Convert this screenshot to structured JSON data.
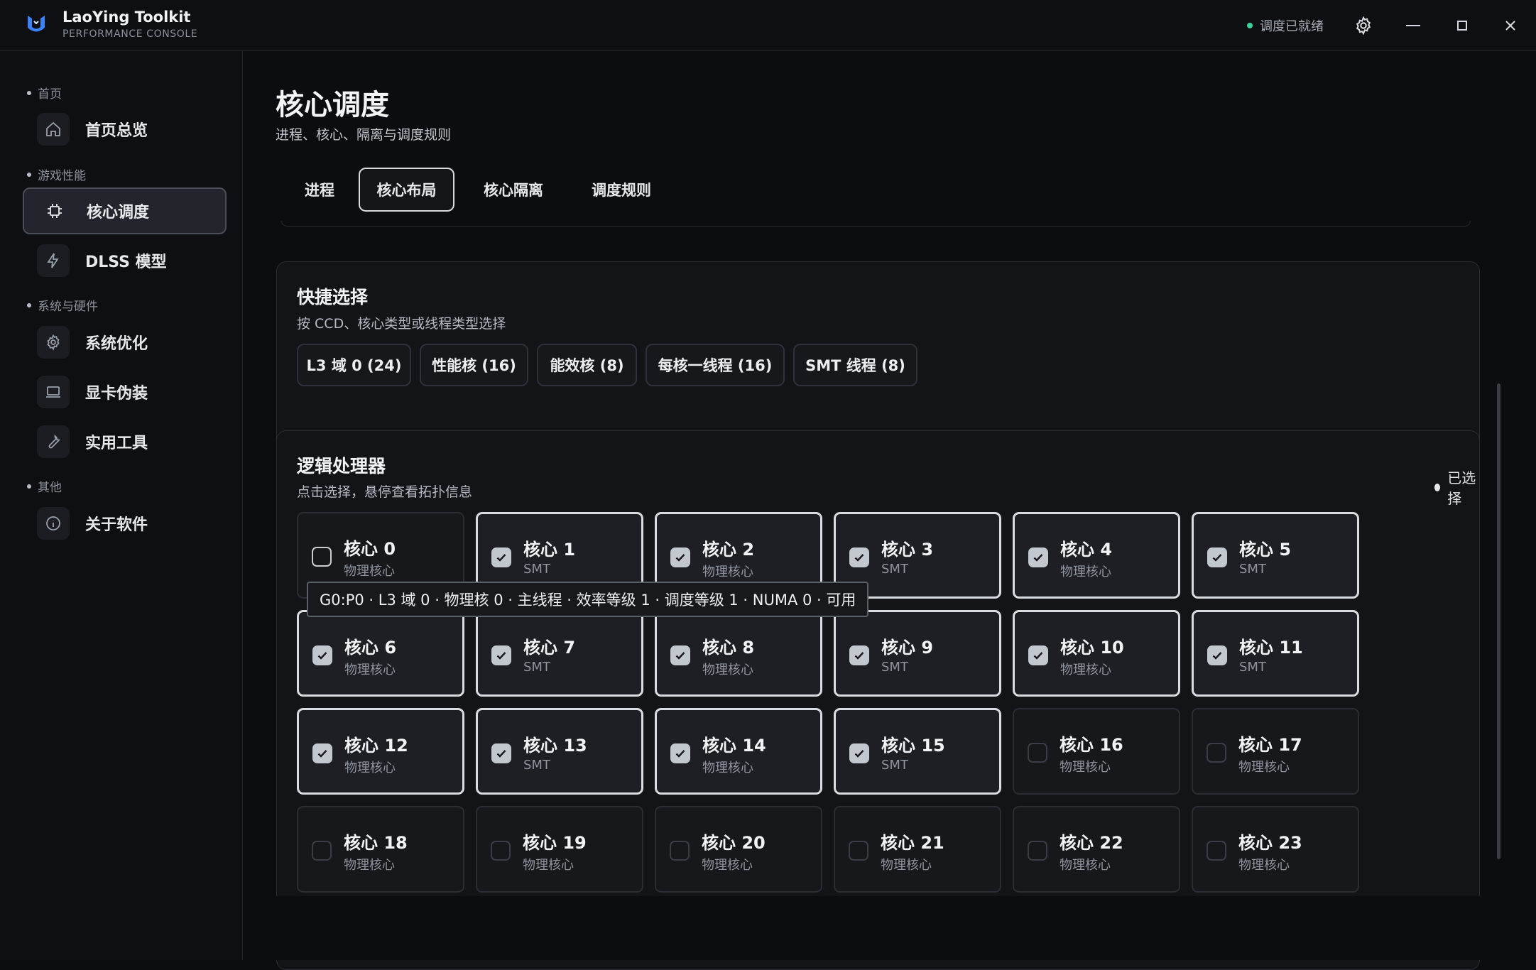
{
  "app": {
    "title": "LaoYing Toolkit",
    "subtitle": "PERFORMANCE CONSOLE",
    "status": "调度已就绪"
  },
  "sidebar": {
    "groups": [
      {
        "label": "首页",
        "items": [
          {
            "label": "首页总览",
            "icon": "home-icon"
          }
        ]
      },
      {
        "label": "游戏性能",
        "items": [
          {
            "label": "核心调度",
            "icon": "chip-icon",
            "active": true
          },
          {
            "label": "DLSS 模型",
            "icon": "bolt-icon"
          }
        ]
      },
      {
        "label": "系统与硬件",
        "items": [
          {
            "label": "系统优化",
            "icon": "gear-icon"
          },
          {
            "label": "显卡伪装",
            "icon": "laptop-icon"
          },
          {
            "label": "实用工具",
            "icon": "wrench-icon"
          }
        ]
      },
      {
        "label": "其他",
        "items": [
          {
            "label": "关于软件",
            "icon": "info-icon"
          }
        ]
      }
    ]
  },
  "page": {
    "title": "核心调度",
    "subtitle": "进程、核心、隔离与调度规则",
    "tabs": [
      {
        "label": "进程"
      },
      {
        "label": "核心布局",
        "active": true
      },
      {
        "label": "核心隔离"
      },
      {
        "label": "调度规则"
      }
    ]
  },
  "quick_select": {
    "title": "快捷选择",
    "subtitle": "按 CCD、核心类型或线程类型选择",
    "chips": [
      "L3 域 0 (24)",
      "性能核 (16)",
      "能效核 (8)",
      "每核一线程 (16)",
      "SMT 线程 (8)"
    ]
  },
  "processors": {
    "title": "逻辑处理器",
    "subtitle": "点击选择，悬停查看拓扑信息",
    "legend": "已选择",
    "tooltip": "G0:P0 · L3 域 0 · 物理核 0 · 主线程 · 效率等级 1 · 调度等级 1 · NUMA 0 · 可用",
    "cores": [
      {
        "name": "核心 0",
        "type": "物理核心",
        "selected": false
      },
      {
        "name": "核心 1",
        "type": "SMT",
        "selected": true
      },
      {
        "name": "核心 2",
        "type": "物理核心",
        "selected": true
      },
      {
        "name": "核心 3",
        "type": "SMT",
        "selected": true
      },
      {
        "name": "核心 4",
        "type": "物理核心",
        "selected": true
      },
      {
        "name": "核心 5",
        "type": "SMT",
        "selected": true
      },
      {
        "name": "核心 6",
        "type": "物理核心",
        "selected": true
      },
      {
        "name": "核心 7",
        "type": "SMT",
        "selected": true
      },
      {
        "name": "核心 8",
        "type": "物理核心",
        "selected": true
      },
      {
        "name": "核心 9",
        "type": "SMT",
        "selected": true
      },
      {
        "name": "核心 10",
        "type": "物理核心",
        "selected": true
      },
      {
        "name": "核心 11",
        "type": "SMT",
        "selected": true
      },
      {
        "name": "核心 12",
        "type": "物理核心",
        "selected": true
      },
      {
        "name": "核心 13",
        "type": "SMT",
        "selected": true
      },
      {
        "name": "核心 14",
        "type": "物理核心",
        "selected": true
      },
      {
        "name": "核心 15",
        "type": "SMT",
        "selected": true
      },
      {
        "name": "核心 16",
        "type": "物理核心",
        "selected": false
      },
      {
        "name": "核心 17",
        "type": "物理核心",
        "selected": false
      },
      {
        "name": "核心 18",
        "type": "物理核心",
        "selected": false
      },
      {
        "name": "核心 19",
        "type": "物理核心",
        "selected": false
      },
      {
        "name": "核心 20",
        "type": "物理核心",
        "selected": false
      },
      {
        "name": "核心 21",
        "type": "物理核心",
        "selected": false
      },
      {
        "name": "核心 22",
        "type": "物理核心",
        "selected": false
      },
      {
        "name": "核心 23",
        "type": "物理核心",
        "selected": false
      }
    ]
  },
  "colors": {
    "background": "#0c0d10",
    "card": "#131418",
    "status_dot": "#3ad29f",
    "selected_border": "#d9dce1"
  }
}
